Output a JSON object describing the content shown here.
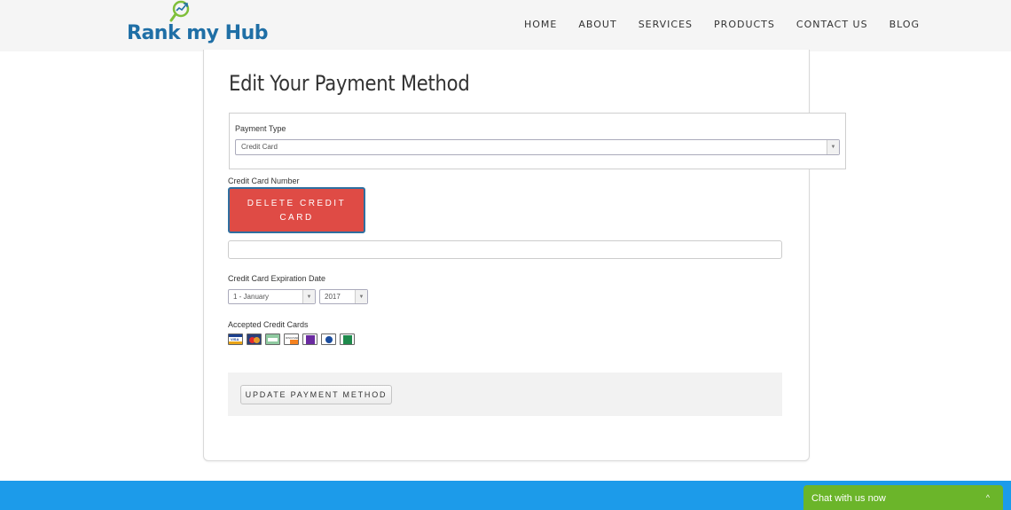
{
  "brand": {
    "logo_text": "Rank my Hub"
  },
  "nav": {
    "items": [
      "HOME",
      "ABOUT",
      "SERVICES",
      "PRODUCTS",
      "CONTACT US",
      "BLOG"
    ]
  },
  "page": {
    "title": "Edit Your Payment Method"
  },
  "payment_type": {
    "label": "Payment Type",
    "value": "Credit Card"
  },
  "credit_card": {
    "number_label": "Credit Card Number",
    "delete_button_label": "DELETE CREDIT CARD",
    "number_value": ""
  },
  "expiration": {
    "label": "Credit Card Expiration Date",
    "month": "1 - January",
    "year": "2017"
  },
  "accepted": {
    "label": "Accepted Credit Cards",
    "cards": [
      "visa",
      "mastercard",
      "amex",
      "discover",
      "purple-card",
      "diners",
      "jcb"
    ]
  },
  "update_button_label": "UPDATE PAYMENT METHOD",
  "chat": {
    "label": "Chat with us now",
    "caret": "^"
  },
  "colors": {
    "delete": "#df4b45",
    "footer": "#1c9bea",
    "chat": "#6bb52a",
    "brand_blue": "#1f6fa6",
    "brand_green": "#7fbf3a"
  }
}
